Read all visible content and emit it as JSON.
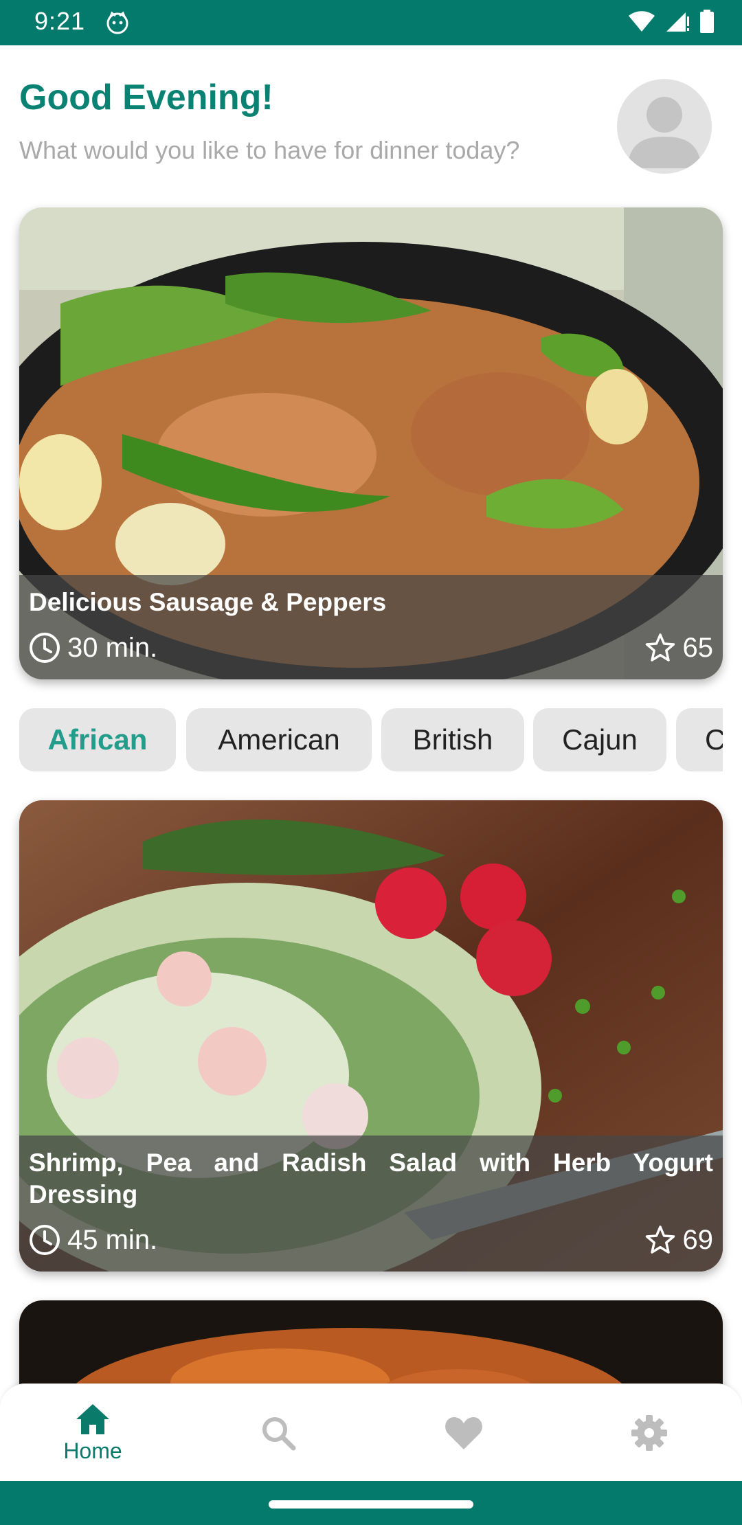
{
  "status_bar": {
    "time": "9:21",
    "background": "#047a6c",
    "icons": [
      "cat-notification-icon",
      "wifi-icon",
      "signal-icon",
      "battery-icon"
    ]
  },
  "header": {
    "greeting": "Good Evening!",
    "subtitle": "What would you like to have for dinner today?",
    "avatar_icon": "person-avatar-icon",
    "accent_color": "#0a8273"
  },
  "featured_recipe": {
    "title": "Delicious Sausage & Peppers",
    "time": "30 min.",
    "rating": "65",
    "time_icon": "clock-icon",
    "rating_icon": "star-outline-icon"
  },
  "categories": {
    "items": [
      "African",
      "American",
      "British",
      "Cajun",
      "C"
    ],
    "selected": "African",
    "selected_color": "#239c8c"
  },
  "recipes": [
    {
      "title": "Shrimp, Pea and Radish Salad with Herb Yogurt Dressing",
      "time": "45 min.",
      "rating": "69"
    }
  ],
  "bottom_nav": {
    "items": [
      {
        "label": "Home",
        "icon": "home-icon",
        "active": true
      },
      {
        "label": "",
        "icon": "search-icon",
        "active": false
      },
      {
        "label": "",
        "icon": "heart-icon",
        "active": false
      },
      {
        "label": "",
        "icon": "gear-icon",
        "active": false
      }
    ],
    "active_color": "#0a7a6a",
    "inactive_color": "#bdbdbd"
  }
}
